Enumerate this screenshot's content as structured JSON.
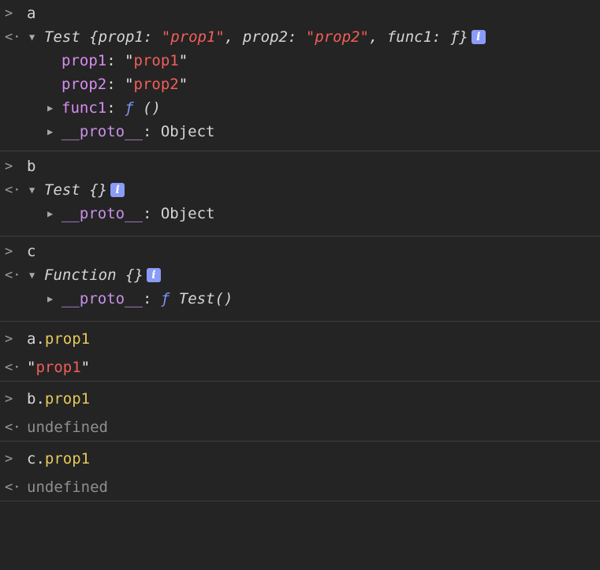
{
  "entries": [
    {
      "input": "a",
      "summary": {
        "class_name": "Test",
        "preview": [
          {
            "key": "prop1",
            "value": "prop1"
          },
          {
            "key": "prop2",
            "value": "prop2"
          },
          {
            "key": "func1",
            "value": "ƒ"
          }
        ]
      },
      "props": [
        {
          "key": "prop1",
          "value": "prop1"
        },
        {
          "key": "prop2",
          "value": "prop2"
        },
        {
          "key": "func1",
          "fsym": "ƒ",
          "value": "()"
        },
        {
          "key": "__proto__",
          "value": "Object"
        }
      ]
    },
    {
      "input": "b",
      "summary": {
        "class_name": "Test",
        "braces": "{}"
      },
      "props": [
        {
          "key": "__proto__",
          "value": "Object"
        }
      ]
    },
    {
      "input": "c",
      "summary": {
        "class_name": "Function",
        "braces": "{}"
      },
      "props": [
        {
          "key": "__proto__",
          "fsym": "ƒ",
          "value": "Test()"
        }
      ]
    },
    {
      "input_object": "a",
      "input_prop": "prop1",
      "result": "prop1"
    },
    {
      "input_object": "b",
      "input_prop": "prop1",
      "result": "undefined"
    },
    {
      "input_object": "c",
      "input_prop": "prop1",
      "result": "undefined"
    }
  ],
  "icons": {
    "input_prompt": "chevron-right-icon",
    "result_prompt": "return-arrow-icon",
    "expanded": "triangle-down-icon",
    "collapsed": "triangle-right-icon",
    "info_badge": "info-icon"
  },
  "info_label": "i",
  "colors": {
    "background": "#242424",
    "key": "#d78cf2",
    "string": "#f25e59",
    "property_ref": "#e4c95c",
    "function_symbol": "#7f93f5",
    "undefined": "#8f8f8f",
    "info_badge": "#8a9cf7"
  }
}
